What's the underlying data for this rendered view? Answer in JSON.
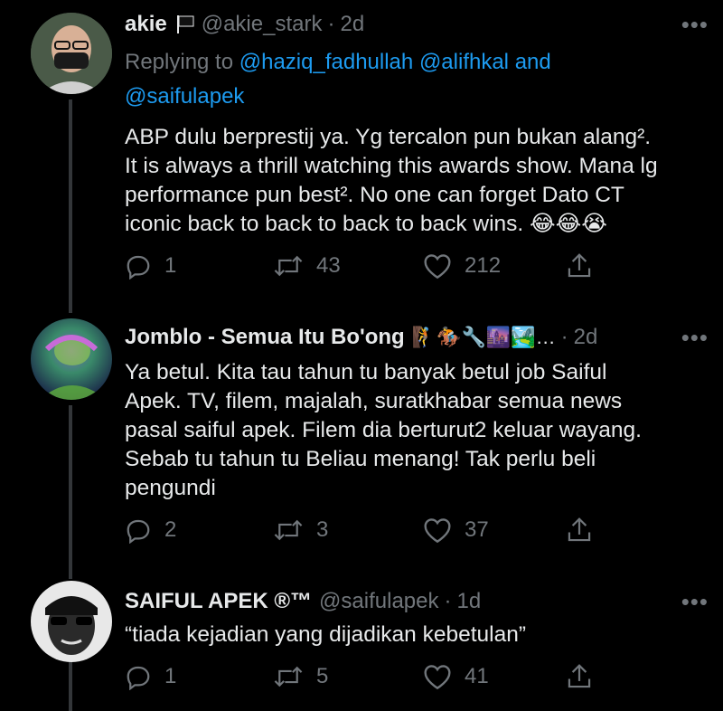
{
  "tweets": [
    {
      "name": "akie",
      "badge": "flag",
      "handle": "@akie_stark",
      "separator": "·",
      "time": "2d",
      "replying_prefix": "Replying to",
      "mentions": [
        "@haziq_fadhullah",
        "@alifhkal"
      ],
      "mention_join": "and",
      "mention_last": "@saifulapek",
      "text_lines": [
        "ABP dulu berprestij ya. Yg tercalon pun bukan alang².",
        "It is always a thrill watching this awards show. Mana lg",
        "performance pun best². No one can forget Dato CT",
        "iconic back to back to back to back wins. 😂😂😭"
      ],
      "replies": "1",
      "retweets": "43",
      "likes": "212"
    },
    {
      "name": "Jomblo - Semua Itu Bo'ong",
      "name_emojis": "🧗🏇🔧🌆🏞️…",
      "separator": "·",
      "time": "2d",
      "text_lines": [
        "Ya betul. Kita tau tahun tu banyak betul job Saiful",
        "Apek. TV, filem, majalah, suratkhabar semua news",
        "pasal saiful apek. Filem dia berturut2 keluar wayang.",
        "Sebab tu tahun tu Beliau menang! Tak perlu beli",
        "pengundi"
      ],
      "replies": "2",
      "retweets": "3",
      "likes": "37"
    },
    {
      "name": "SAIFUL APEK ®™",
      "handle": "@saifulapek",
      "separator": "·",
      "time": "1d",
      "text_lines": [
        "“tiada kejadian yang dijadikan kebetulan”"
      ],
      "replies": "1",
      "retweets": "5",
      "likes": "41"
    }
  ],
  "more_label": "•••",
  "icons": [
    "reply-icon",
    "retweet-icon",
    "like-icon",
    "share-icon",
    "more-icon"
  ]
}
